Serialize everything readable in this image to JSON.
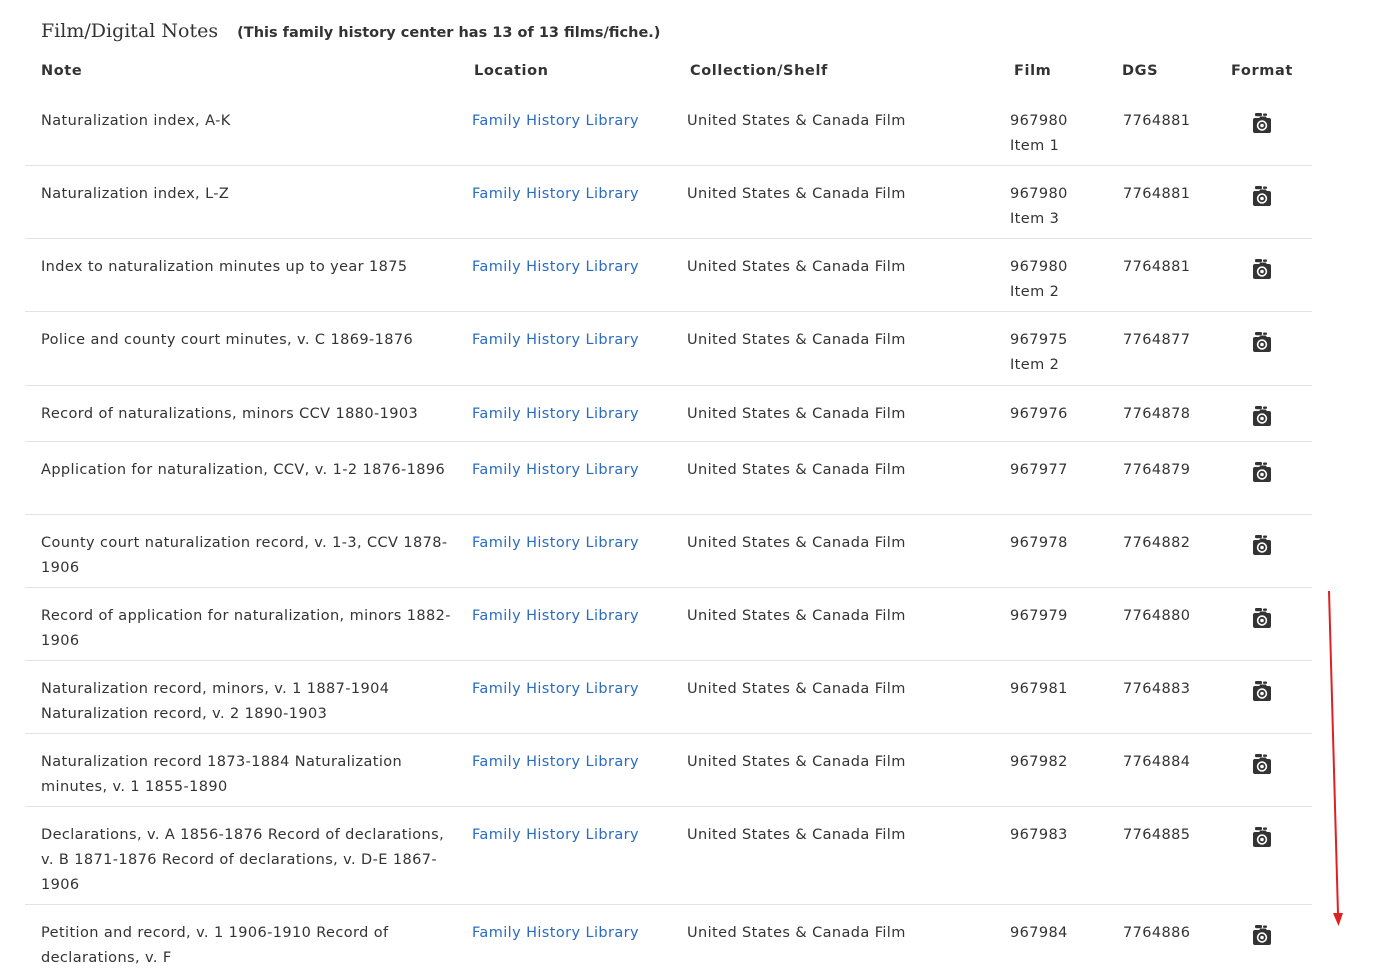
{
  "heading": {
    "title": "Film/Digital Notes",
    "subtitle": "(This family history center has 13 of 13 films/fiche.)"
  },
  "columns": {
    "note": "Note",
    "location": "Location",
    "collection": "Collection/Shelf",
    "film": "Film",
    "dgs": "DGS",
    "format": "Format"
  },
  "rows": [
    {
      "note": "Naturalization index, A-K",
      "location": "Family History Library",
      "collection": "United States & Canada Film",
      "film": "967980",
      "item": "Item 1",
      "dgs": "7764881",
      "format_icon": "camera-icon"
    },
    {
      "note": "Naturalization index, L-Z",
      "location": "Family History Library",
      "collection": "United States & Canada Film",
      "film": "967980",
      "item": "Item 3",
      "dgs": "7764881",
      "format_icon": "camera-icon"
    },
    {
      "note": "Index to naturalization minutes up to year 1875",
      "location": "Family History Library",
      "collection": "United States & Canada Film",
      "film": "967980",
      "item": "Item 2",
      "dgs": "7764881",
      "format_icon": "camera-icon"
    },
    {
      "note": "Police and county court minutes, v. C 1869-1876",
      "location": "Family History Library",
      "collection": "United States & Canada Film",
      "film": "967975",
      "item": "Item 2",
      "dgs": "7764877",
      "format_icon": "camera-icon"
    },
    {
      "note": "Record of naturalizations, minors CCV 1880-1903",
      "location": "Family History Library",
      "collection": "United States & Canada Film",
      "film": "967976",
      "item": "",
      "dgs": "7764878",
      "format_icon": "camera-icon"
    },
    {
      "note": "Application for naturalization, CCV, v. 1-2 1876-1896",
      "location": "Family History Library",
      "collection": "United States & Canada Film",
      "film": "967977",
      "item": "",
      "dgs": "7764879",
      "format_icon": "camera-icon"
    },
    {
      "note": "County court naturalization record, v. 1-3, CCV 1878-1906",
      "location": "Family History Library",
      "collection": "United States & Canada Film",
      "film": "967978",
      "item": "",
      "dgs": "7764882",
      "format_icon": "camera-icon"
    },
    {
      "note": "Record of application for naturalization, minors 1882-1906",
      "location": "Family History Library",
      "collection": "United States & Canada Film",
      "film": "967979",
      "item": "",
      "dgs": "7764880",
      "format_icon": "camera-icon"
    },
    {
      "note": "Naturalization record, minors, v. 1 1887-1904 Naturalization record, v. 2 1890-1903",
      "location": "Family History Library",
      "collection": "United States & Canada Film",
      "film": "967981",
      "item": "",
      "dgs": "7764883",
      "format_icon": "camera-icon"
    },
    {
      "note": "Naturalization record 1873-1884 Naturalization minutes, v. 1 1855-1890",
      "location": "Family History Library",
      "collection": "United States & Canada Film",
      "film": "967982",
      "item": "",
      "dgs": "7764884",
      "format_icon": "camera-icon"
    },
    {
      "note": "Declarations, v. A 1856-1876 Record of declarations, v. B 1871-1876 Record of declarations, v. D-E 1867-1906",
      "location": "Family History Library",
      "collection": "United States & Canada Film",
      "film": "967983",
      "item": "",
      "dgs": "7764885",
      "format_icon": "camera-icon"
    },
    {
      "note": "Petition and record, v. 1 1906-1910 Record of declarations, v. F",
      "location": "Family History Library",
      "collection": "United States & Canada Film",
      "film": "967984",
      "item": "",
      "dgs": "7764886",
      "format_icon": "camera-icon"
    }
  ],
  "colors": {
    "link": "#2a6cc2",
    "text": "#333333",
    "divider": "#e3e3e3",
    "annotation_arrow": "#e02020"
  }
}
